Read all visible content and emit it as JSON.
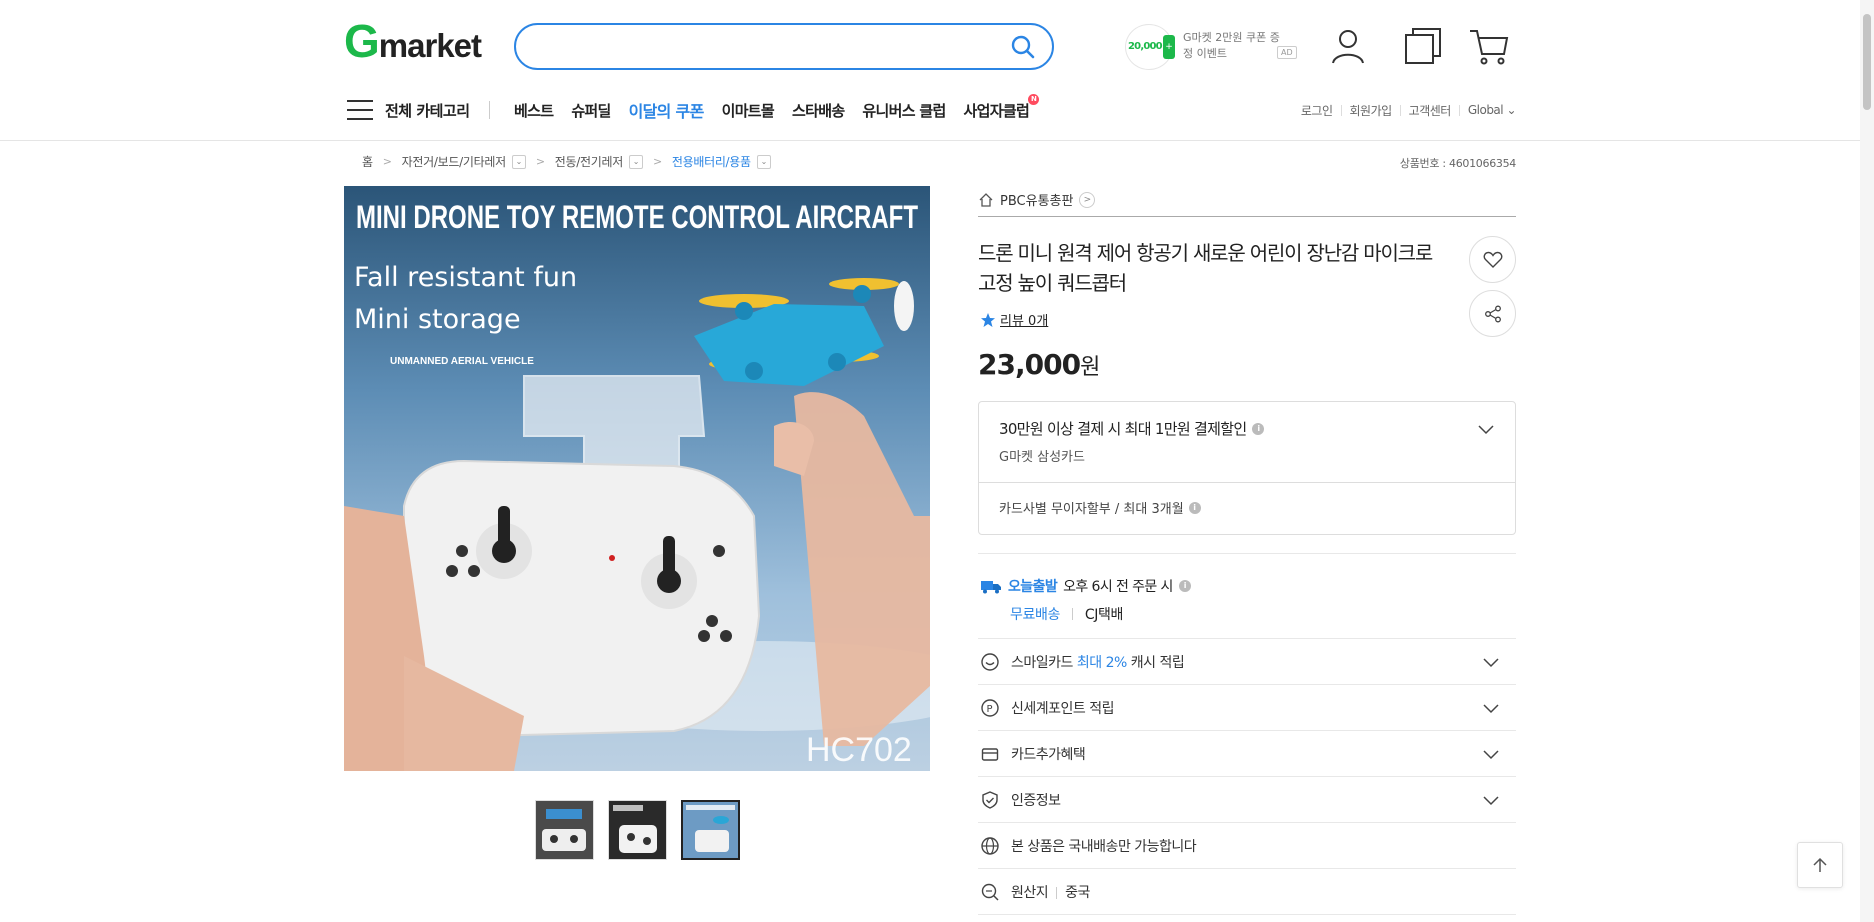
{
  "header": {
    "logo_g": "G",
    "logo_rest": "market",
    "search_placeholder": "",
    "coupon_amount": "20,000",
    "coupon_text": "G마켓 2만원 쿠폰 증정 이벤트",
    "ad_label": "AD"
  },
  "nav": {
    "all_categories": "전체 카테고리",
    "items": [
      "베스트",
      "슈퍼딜",
      "이달의 쿠폰",
      "이마트몰",
      "스타배송",
      "유니버스 클럽",
      "사업자클럽"
    ],
    "badge": "N",
    "right_links": [
      "로그인",
      "회원가입",
      "고객센터",
      "Global ⌄"
    ]
  },
  "breadcrumb": {
    "items": [
      "홈",
      "자전거/보드/기타레저",
      "전동/전기레저",
      "전용배터리/용품"
    ]
  },
  "product_no": "상품번호 : 4601066354",
  "image_text": {
    "headline": "MINI DRONE TOY REMOTE CONTROL AIRCRAFT",
    "line1": "Fall resistant fun",
    "line2": "Mini storage",
    "line3": "UNMANNED AERIAL VEHICLE",
    "model": "HC702"
  },
  "seller": "PBC유통총판",
  "title": "드론 미니 원격 제어 항공기 새로운 어린이 장난감 마이크로 고정 높이 쿼드콥터",
  "review": "리뷰 0개",
  "price": "23,000",
  "price_unit": "원",
  "card": {
    "title": "30만원 이상 결제 시 최대 1만원 결제할인",
    "sub": "G마켓 삼성카드",
    "installment": "카드사별 무이자할부 / 최대 3개월"
  },
  "shipping": {
    "today": "오늘출발",
    "today_desc": "오후 6시 전 주문 시",
    "free": "무료배송",
    "carrier": "CJ택배"
  },
  "benefits": {
    "smile_prefix": "스마일카드 ",
    "smile_hl": "최대 2%",
    "smile_suffix": " 캐시 적립",
    "shinsegae": "신세계포인트 적립",
    "card_extra": "카드추가혜택",
    "cert": "인증정보",
    "domestic": "본 상품은 국내배송만 가능합니다",
    "origin_label": "원산지",
    "origin_value": "중국"
  },
  "colors": {
    "brand_green": "#1cb84a",
    "accent_blue": "#2b85e4"
  }
}
